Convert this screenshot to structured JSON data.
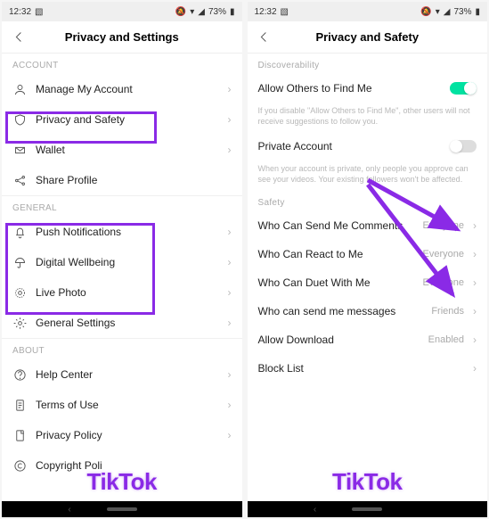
{
  "statusbar": {
    "time": "12:32",
    "battery": "73%"
  },
  "left": {
    "title": "Privacy and Settings",
    "sections": {
      "account_label": "ACCOUNT",
      "general_label": "GENERAL",
      "about_label": "ABOUT"
    },
    "items": {
      "manage": "Manage My Account",
      "privacy": "Privacy and Safety",
      "wallet": "Wallet",
      "share": "Share Profile",
      "push": "Push Notifications",
      "wellbeing": "Digital Wellbeing",
      "live": "Live Photo",
      "general": "General Settings",
      "help": "Help Center",
      "terms": "Terms of Use",
      "priv_policy": "Privacy Policy",
      "copyright": "Copyright Poli"
    }
  },
  "right": {
    "title": "Privacy and Safety",
    "disc_label": "Discoverability",
    "safety_label": "Safety",
    "allow_find": "Allow Others to Find Me",
    "allow_find_help": "If you disable \"Allow Others to Find Me\", other users will not receive suggestions to follow you.",
    "private": "Private Account",
    "private_help": "When your account is private, only people you approve can see your videos. Your existing followers won't be affected.",
    "items": {
      "comments": {
        "label": "Who Can Send Me Comments",
        "value": "Everyone"
      },
      "react": {
        "label": "Who Can React to Me",
        "value": "Everyone"
      },
      "duet": {
        "label": "Who Can Duet With Me",
        "value": "Everyone"
      },
      "messages": {
        "label": "Who can send me messages",
        "value": "Friends"
      },
      "download": {
        "label": "Allow Download",
        "value": "Enabled"
      },
      "block": {
        "label": "Block List",
        "value": ""
      }
    }
  },
  "watermark": "TikTok"
}
